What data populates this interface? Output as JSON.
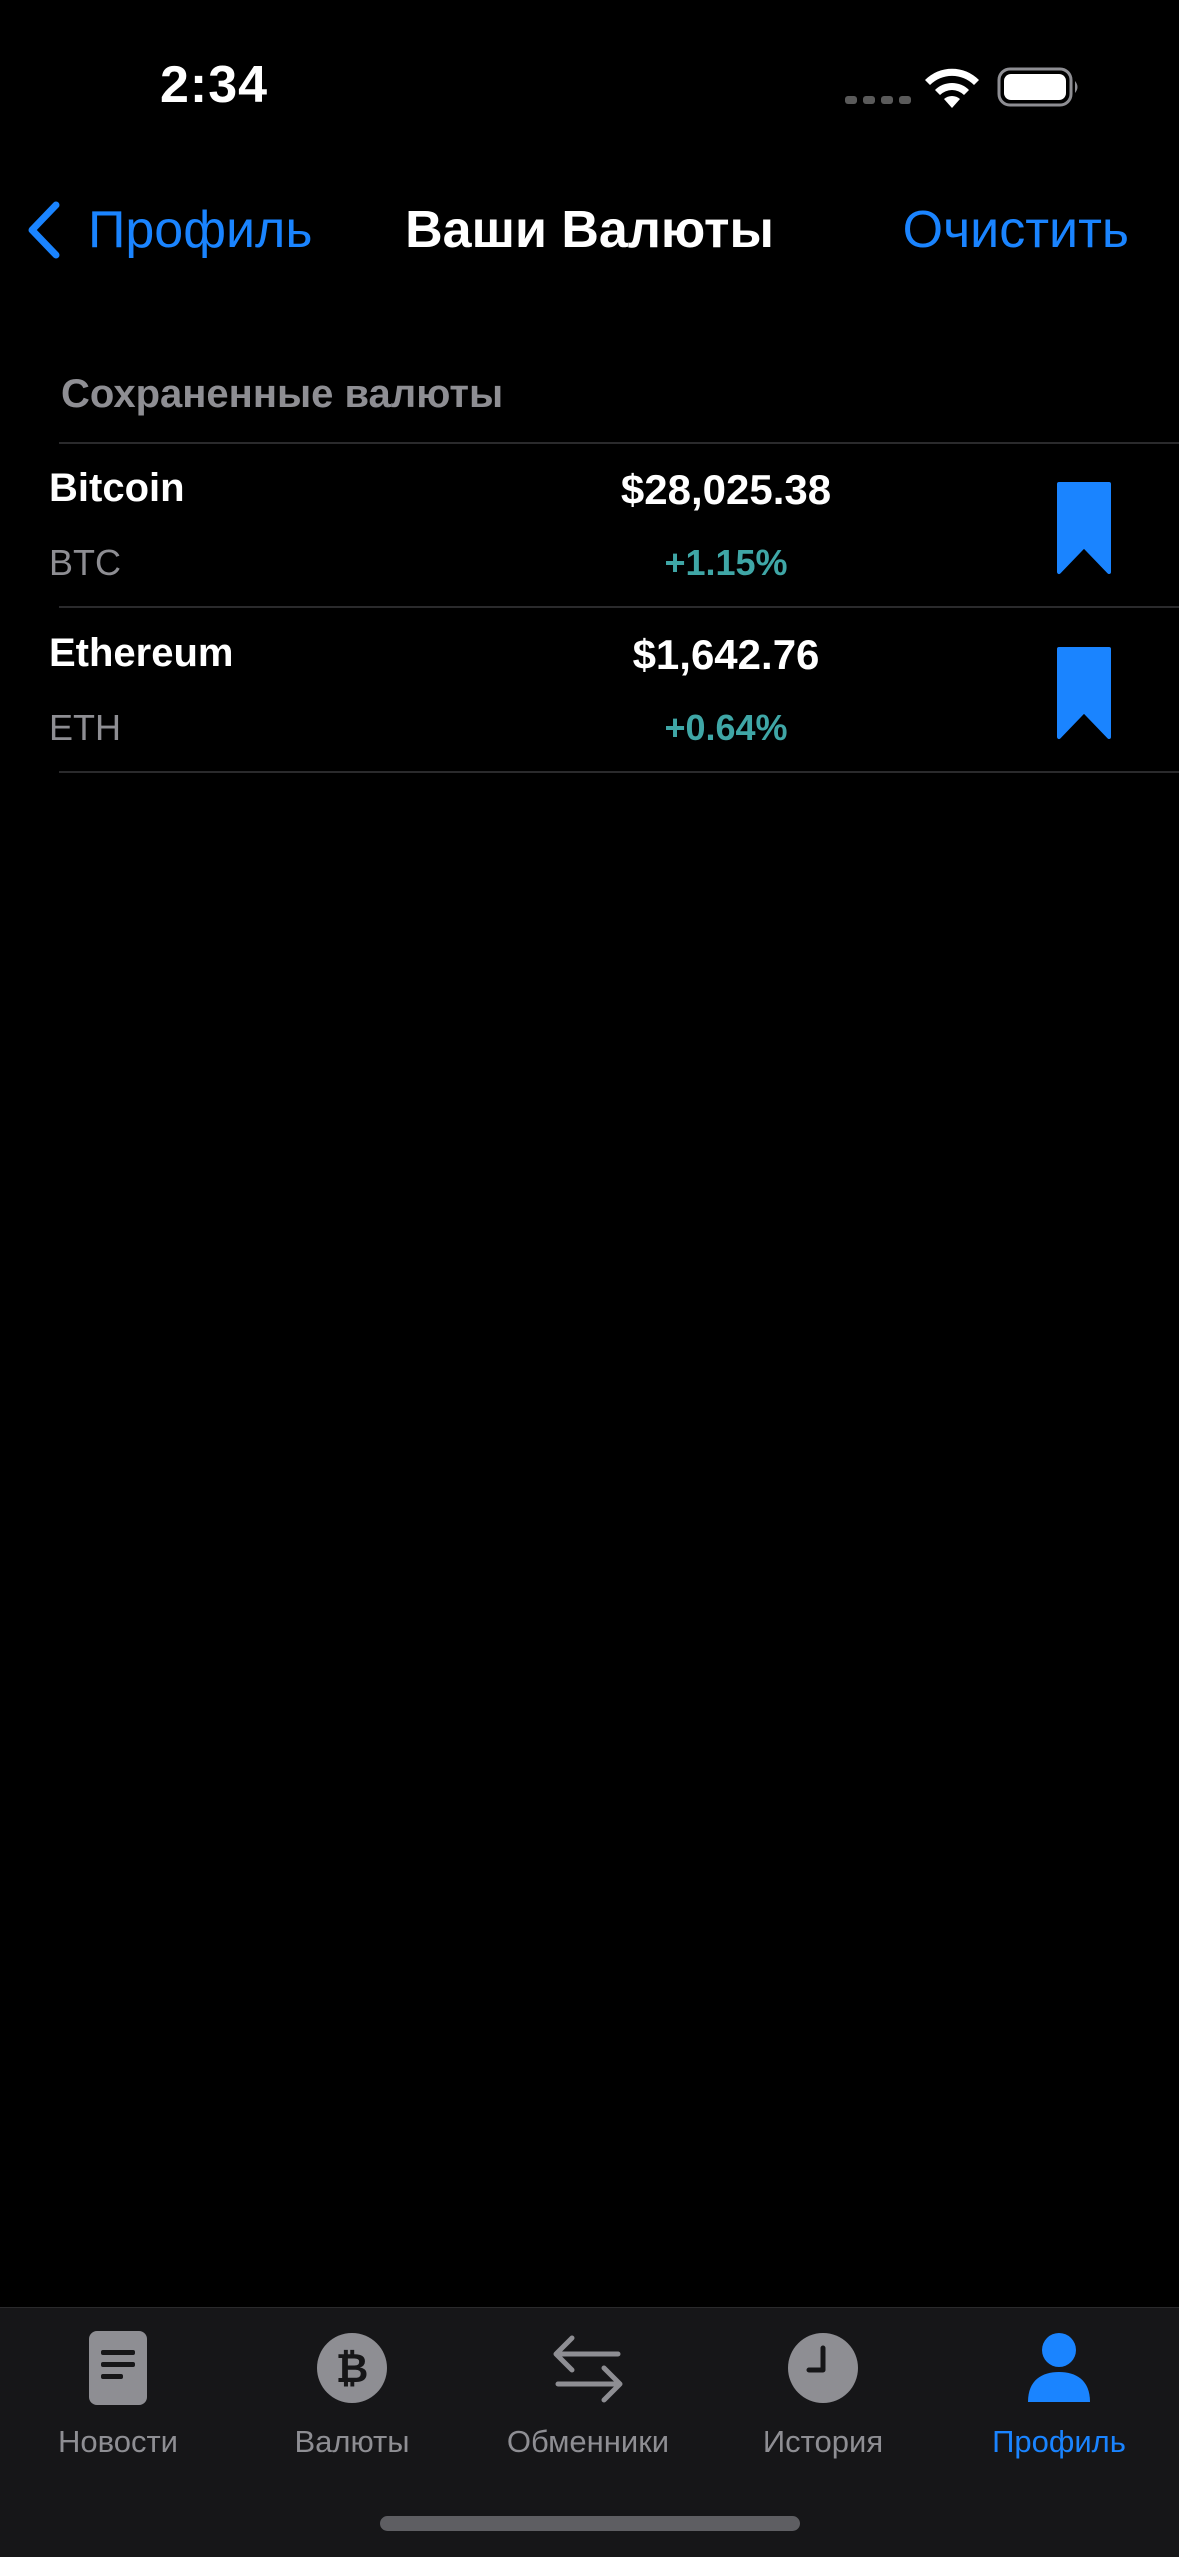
{
  "status_bar": {
    "time": "2:34"
  },
  "nav": {
    "back_label": "Профиль",
    "title": "Ваши Валюты",
    "action_label": "Очистить"
  },
  "section": {
    "header": "Сохраненные валюты"
  },
  "currencies": [
    {
      "name": "Bitcoin",
      "ticker": "BTC",
      "price": "$28,025.38",
      "change": "+1.15%",
      "bookmarked": true
    },
    {
      "name": "Ethereum",
      "ticker": "ETH",
      "price": "$1,642.76",
      "change": "+0.64%",
      "bookmarked": true
    }
  ],
  "tabs": [
    {
      "label": "Новости",
      "icon": "news-icon",
      "active": false
    },
    {
      "label": "Валюты",
      "icon": "bitcoin-icon",
      "active": false
    },
    {
      "label": "Обменники",
      "icon": "exchange-arrows-icon",
      "active": false
    },
    {
      "label": "История",
      "icon": "clock-icon",
      "active": false
    },
    {
      "label": "Профиль",
      "icon": "person-icon",
      "active": true
    }
  ],
  "colors": {
    "accent": "#1a84ff",
    "positive_change": "#3fa6a6",
    "secondary_text": "#8e8e93",
    "background": "#000000",
    "tab_bar_background": "#161618"
  }
}
